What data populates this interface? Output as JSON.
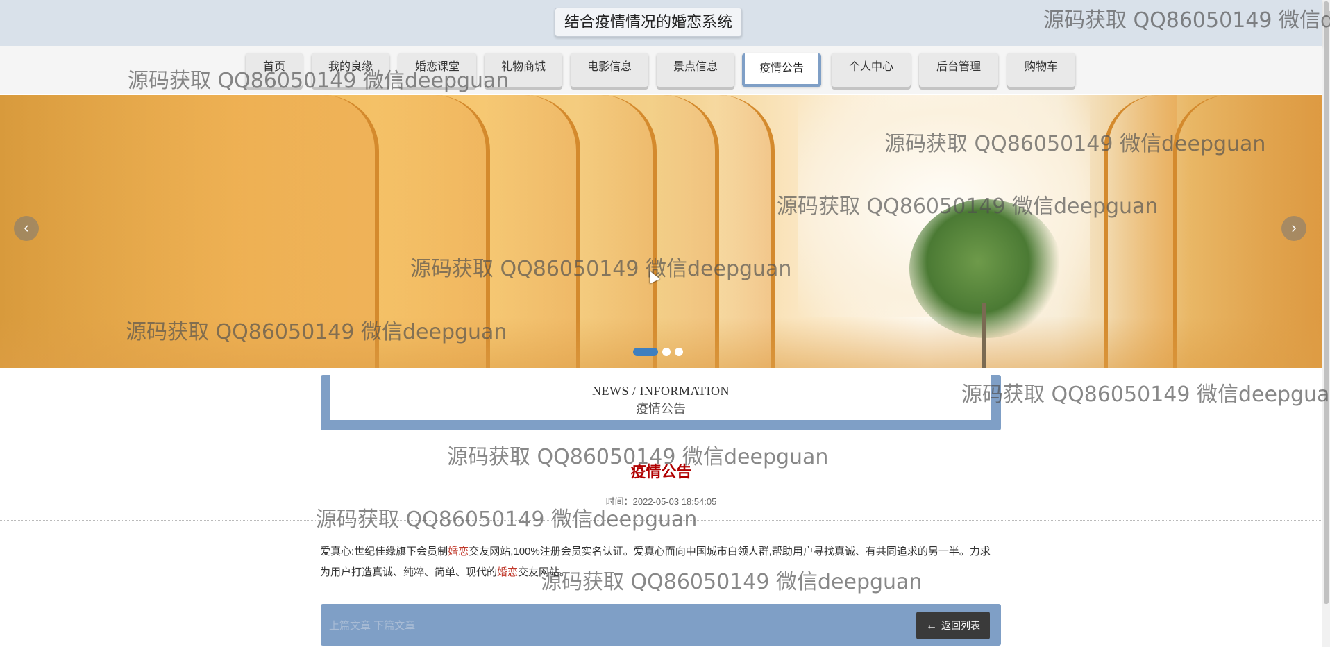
{
  "header": {
    "title": "结合疫情情况的婚恋系统"
  },
  "nav": {
    "items": [
      {
        "label": "首页"
      },
      {
        "label": "我的良缘"
      },
      {
        "label": "婚恋课堂"
      },
      {
        "label": "礼物商城"
      },
      {
        "label": "电影信息"
      },
      {
        "label": "景点信息"
      },
      {
        "label": "疫情公告",
        "active": true
      },
      {
        "label": "个人中心"
      },
      {
        "label": "后台管理"
      },
      {
        "label": "购物车"
      }
    ]
  },
  "carousel": {
    "prev_icon": "chevron-left-icon",
    "next_icon": "chevron-right-icon",
    "slide_count": 3,
    "active_index": 0
  },
  "section": {
    "title_en": "NEWS / INFORMATION",
    "title_cn": "疫情公告"
  },
  "article": {
    "title": "疫情公告",
    "time": "时间：2022-05-03 18:54:05",
    "body_part1": "爱真心:世纪佳缘旗下会员制",
    "body_hl1": "婚恋",
    "body_part2": "交友网站,100%注册会员实名认证。爱真心面向中国城市白领人群,帮助用户寻找真诚、有共同追求的另一半。力求为用户打造真诚、纯粹、简单、现代的",
    "body_hl2": "婚恋",
    "body_part3": "交友网站。"
  },
  "footer_bar": {
    "prev_next": "上篇文章  下篇文章",
    "back_label": "返回列表",
    "back_icon": "arrow-left-icon"
  },
  "watermark": {
    "text": "源码获取 QQ86050149 微信deepguan",
    "text_cut": "源码获取 QQ86050149 微信de"
  },
  "colors": {
    "accent": "#7f9fc6",
    "title_red": "#b00000",
    "topbar": "#d9e1ea"
  }
}
